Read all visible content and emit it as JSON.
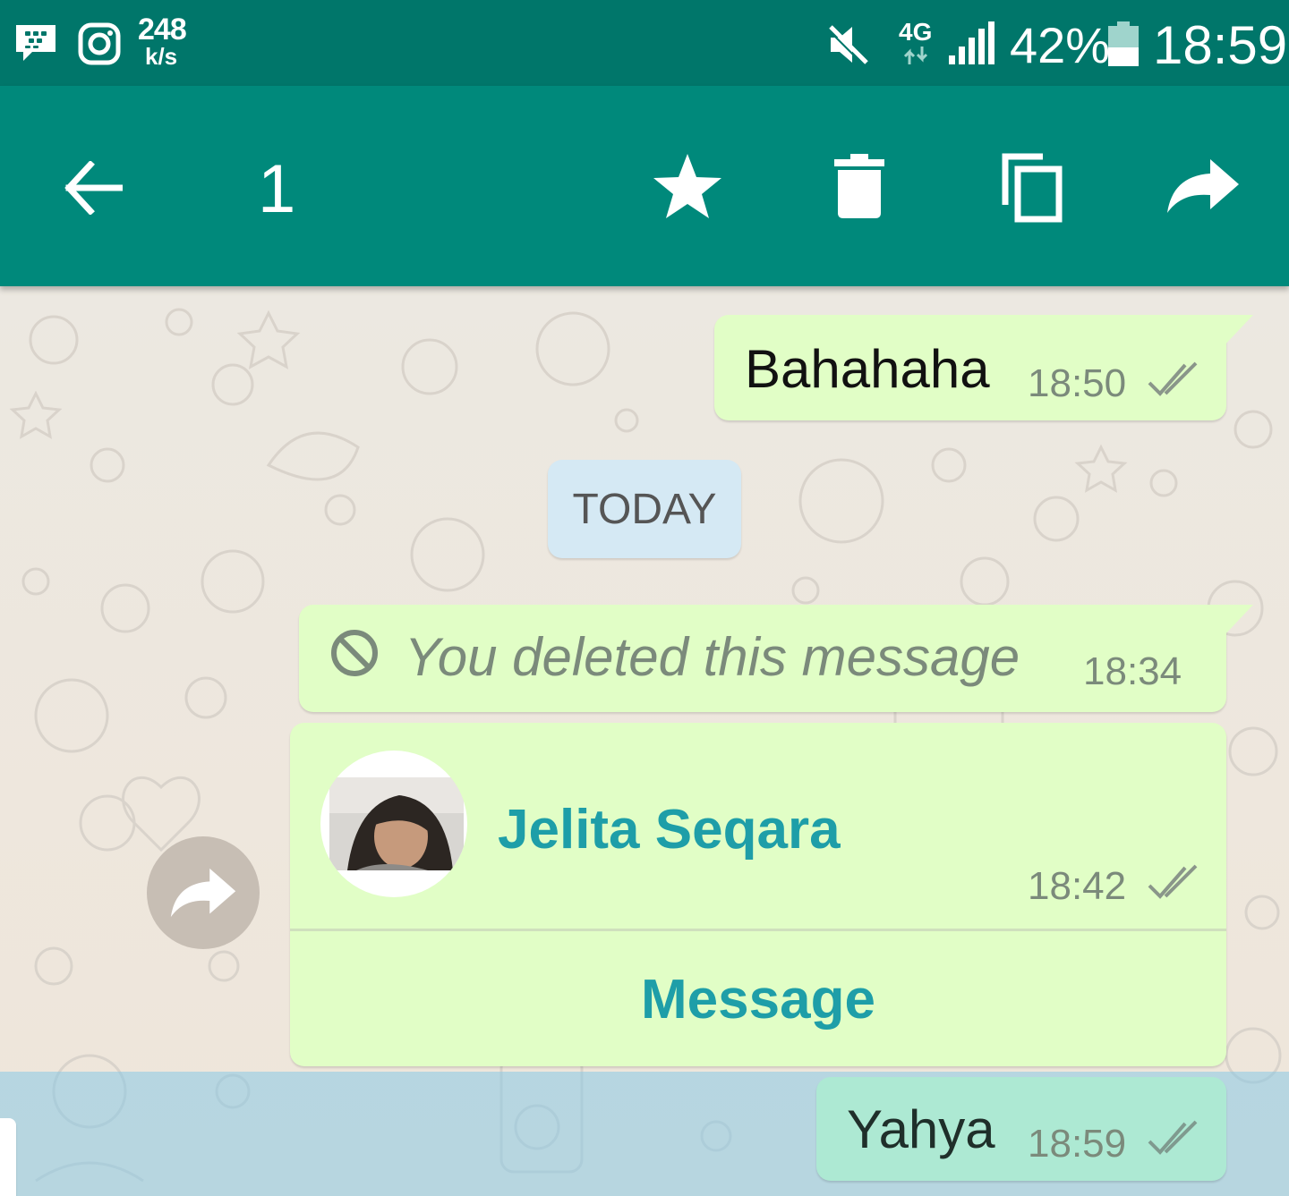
{
  "status_bar": {
    "speed_value": "248",
    "speed_unit": "k/s",
    "network": "4G",
    "battery": "42%",
    "clock": "18:59",
    "icons": [
      "bbm-icon",
      "instagram-icon",
      "mute-icon",
      "data-arrows-icon",
      "signal-icon",
      "battery-icon"
    ]
  },
  "action_bar": {
    "selected_count": "1",
    "icons": [
      "back-arrow-icon",
      "star-icon",
      "delete-icon",
      "copy-icon",
      "forward-icon"
    ]
  },
  "chat": {
    "messages": [
      {
        "type": "text",
        "text": "Bahahaha",
        "time": "18:50",
        "status": "read"
      },
      {
        "type": "date",
        "text": "TODAY"
      },
      {
        "type": "deleted",
        "text": "You deleted this message",
        "time": "18:34"
      },
      {
        "type": "contact",
        "name": "Jelita Seqara",
        "time": "18:42",
        "status": "read",
        "action": "Message"
      },
      {
        "type": "text",
        "text": "Yahya",
        "time": "18:59",
        "status": "read",
        "selected": true
      }
    ]
  },
  "colors": {
    "status_bar": "#00766a",
    "action_bar": "#00897b",
    "outgoing_bubble": "#e1fec6",
    "selected_bubble": "#ade9d3",
    "accent": "#1e9ea8"
  }
}
